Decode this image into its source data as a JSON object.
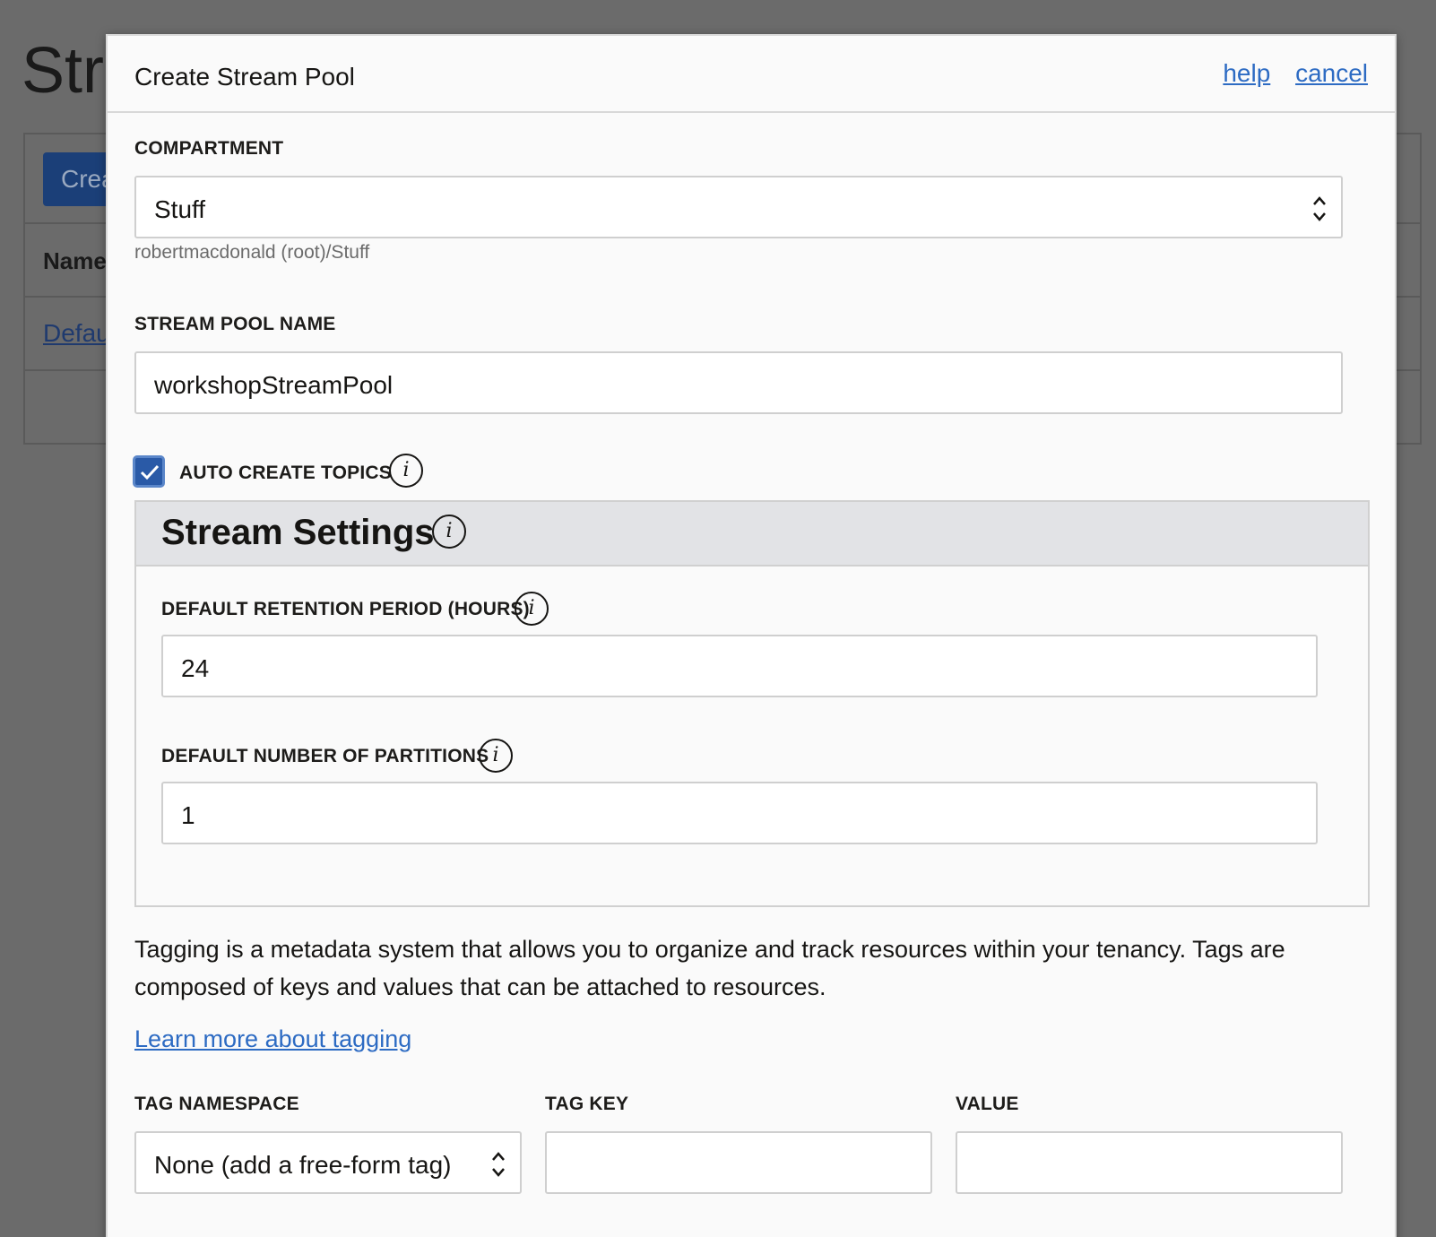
{
  "background": {
    "title": "Str",
    "button_label": "Crea",
    "column_header": "Name",
    "row_link": "Defau"
  },
  "dialog": {
    "title": "Create Stream Pool",
    "help_label": "help",
    "cancel_label": "cancel"
  },
  "compartment": {
    "label": "COMPARTMENT",
    "value": "Stuff",
    "helper": "robertmacdonald (root)/Stuff"
  },
  "stream_pool_name": {
    "label": "STREAM POOL NAME",
    "value": "workshopStreamPool"
  },
  "auto_create_topics": {
    "label": "AUTO CREATE TOPICS",
    "checked": true
  },
  "stream_settings": {
    "title": "Stream Settings",
    "retention": {
      "label": "DEFAULT RETENTION PERIOD (HOURS)",
      "value": "24"
    },
    "partitions": {
      "label": "DEFAULT NUMBER OF PARTITIONS",
      "value": "1"
    }
  },
  "tagging": {
    "description": "Tagging is a metadata system that allows you to organize and track resources within your tenancy. Tags are composed of keys and values that can be attached to resources.",
    "learn_more": "Learn more about tagging",
    "namespace_label": "TAG NAMESPACE",
    "namespace_value": "None (add a free-form tag)",
    "key_label": "TAG KEY",
    "key_value": "",
    "value_label": "VALUE",
    "value_value": ""
  },
  "icons": {
    "info": "info-icon",
    "checkbox": "checkmark-icon",
    "select": "chevron-updown-icon"
  },
  "colors": {
    "link": "#2d6bc3",
    "checkbox": "#2a5aa7",
    "settings_header": "#e2e3e6",
    "overlay": "#6b6b6b"
  }
}
